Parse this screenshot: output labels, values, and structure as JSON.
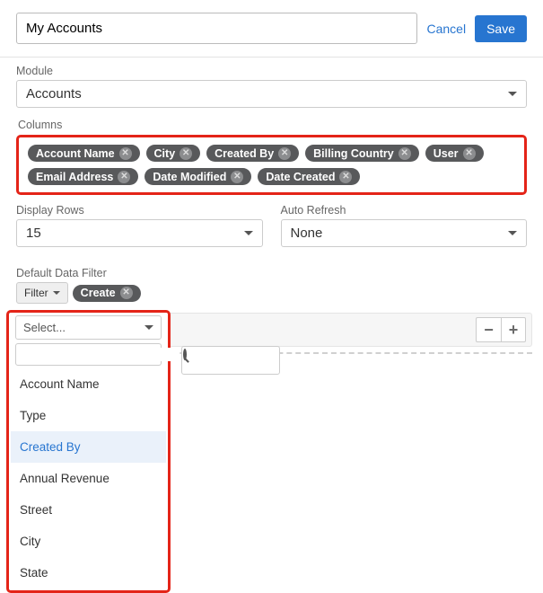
{
  "header": {
    "title_value": "My Accounts",
    "cancel": "Cancel",
    "save": "Save"
  },
  "module": {
    "label": "Module",
    "value": "Accounts"
  },
  "columns": {
    "label": "Columns",
    "chips": [
      "Account Name",
      "City",
      "Created By",
      "Billing Country",
      "User",
      "Email Address",
      "Date Modified",
      "Date Created"
    ]
  },
  "display_rows": {
    "label": "Display Rows",
    "value": "15"
  },
  "auto_refresh": {
    "label": "Auto Refresh",
    "value": "None"
  },
  "filter_section": {
    "label": "Default Data Filter",
    "filter_btn": "Filter",
    "create_chip": "Create"
  },
  "dropdown": {
    "placeholder": "Select...",
    "search_placeholder": "",
    "items": [
      "Account Name",
      "Type",
      "Created By",
      "Annual Revenue",
      "Street",
      "City",
      "State"
    ],
    "hover_index": 2
  },
  "icons": {
    "minus": "−",
    "plus": "+"
  }
}
